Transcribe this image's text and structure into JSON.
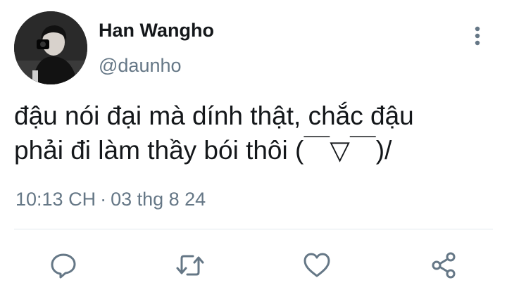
{
  "user": {
    "display_name": "Han Wangho",
    "handle": "@daunho"
  },
  "tweet": {
    "text": "đậu nói đại mà dính thật, chắc đậu\nphải đi làm thầy bói thôi (￣▽￣)/"
  },
  "meta": {
    "time": "10:13 CH",
    "separator": "·",
    "date": "03 thg 8 24"
  },
  "icons": {
    "more": "more-vertical-icon",
    "reply": "reply-icon",
    "retweet": "retweet-icon",
    "like": "heart-icon",
    "share": "share-icon"
  },
  "colors": {
    "text": "#14171a",
    "secondary": "#657786",
    "divider": "#e1e8ed"
  }
}
